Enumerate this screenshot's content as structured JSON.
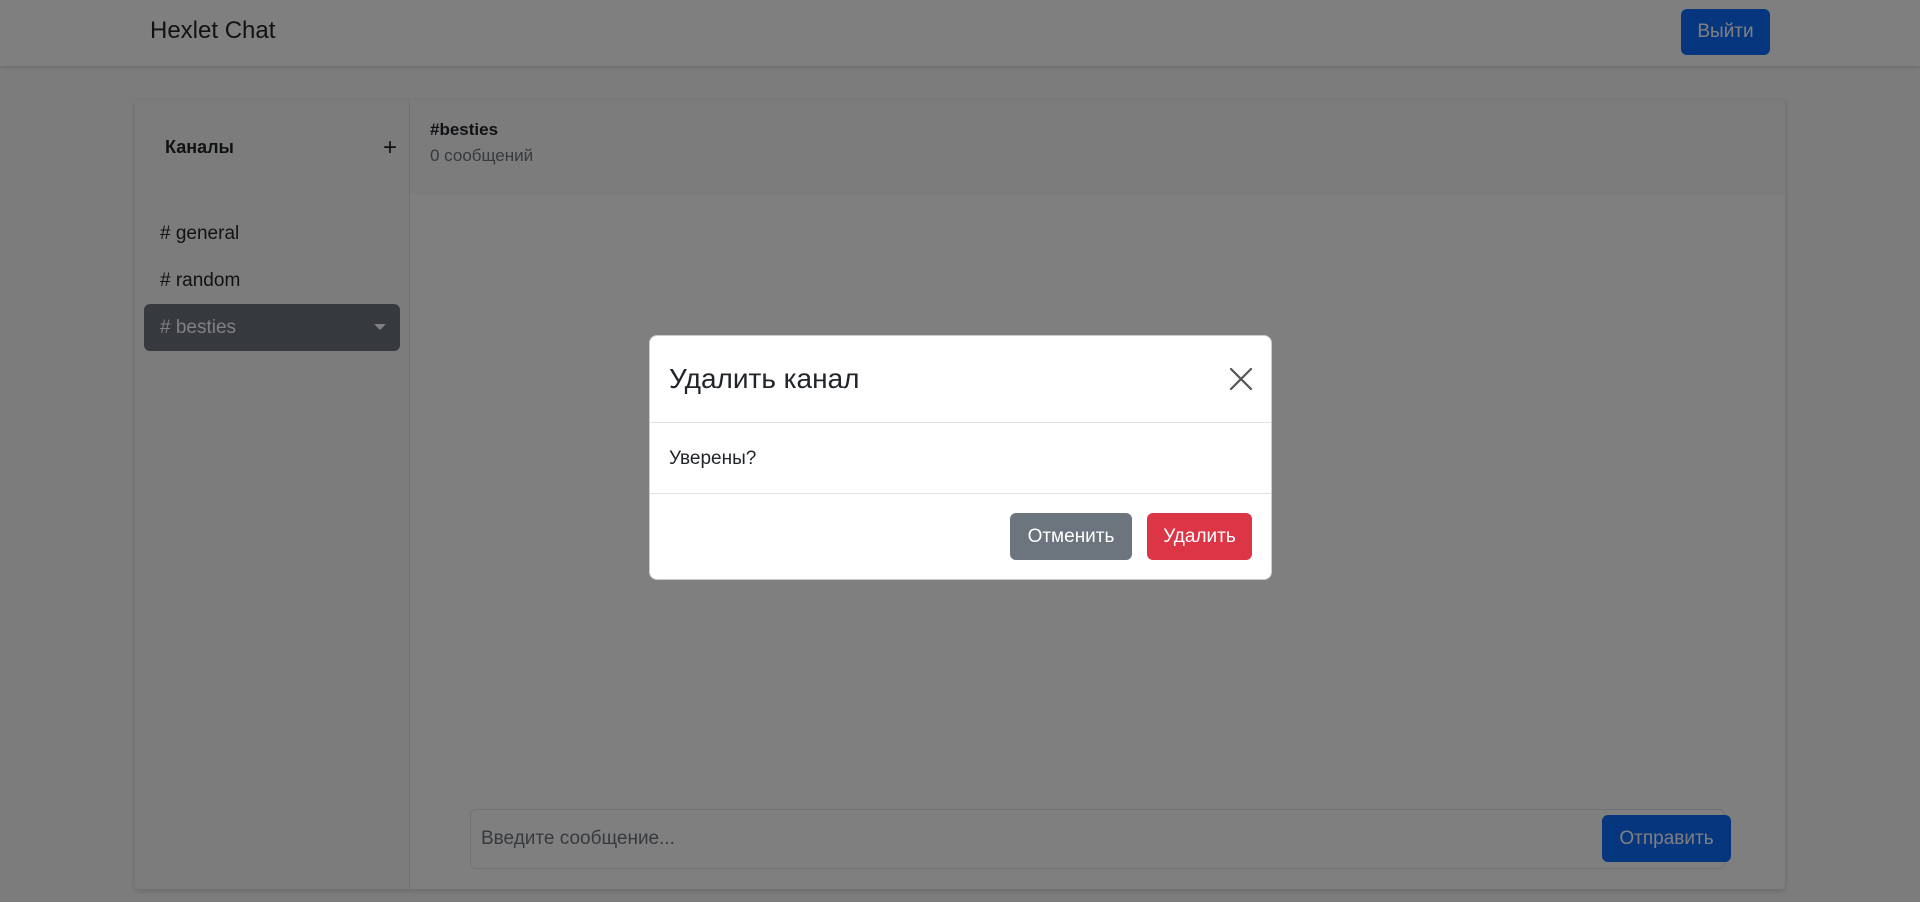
{
  "navbar": {
    "brand": "Hexlet Chat",
    "logout_label": "Выйти"
  },
  "sidebar": {
    "title": "Каналы",
    "add_label": "+",
    "channels": [
      {
        "label": "# general",
        "active": false
      },
      {
        "label": "# random",
        "active": false
      },
      {
        "label": "# besties",
        "active": true
      }
    ]
  },
  "chat": {
    "channel_name": "#besties",
    "message_count": "0 сообщений",
    "input_placeholder": "Введите сообщение...",
    "send_label": "Отправить"
  },
  "modal": {
    "title": "Удалить канал",
    "body": "Уверены?",
    "cancel_label": "Отменить",
    "delete_label": "Удалить"
  },
  "colors": {
    "primary": "#0d6efd",
    "secondary": "#6c757d",
    "danger": "#dc3545",
    "backdrop": "rgba(0,0,0,0.5)"
  }
}
